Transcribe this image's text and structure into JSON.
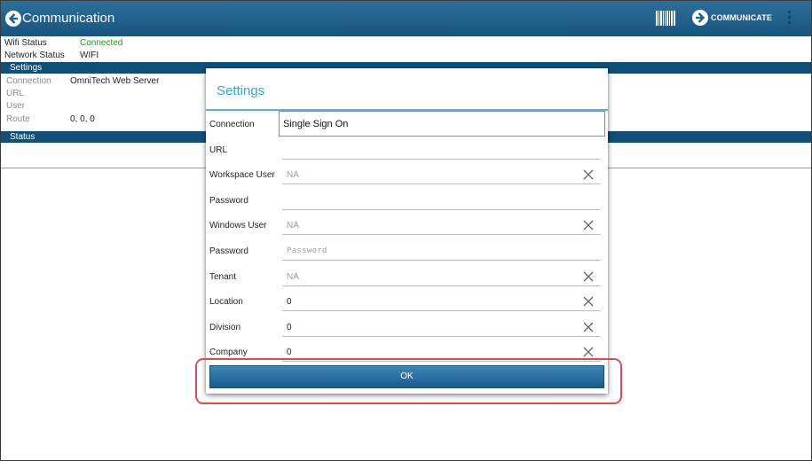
{
  "appbar": {
    "title": "Communication",
    "communicate_label": "COMMUNICATE"
  },
  "status_info": {
    "wifi_label": "Wifi Status",
    "wifi_value": "Connected",
    "wifi_color": "#1a9a1a",
    "network_label": "Network Status",
    "network_value": "WIFI"
  },
  "settings_section": {
    "header": "Settings",
    "connection_label": "Connection",
    "connection_value": "OmniTech Web Server",
    "url_label": "URL",
    "user_label": "User",
    "route_label": "Route",
    "route_value": "0, 0, 0"
  },
  "status_section": {
    "header": "Status"
  },
  "dialog": {
    "title": "Settings",
    "connection": {
      "label": "Connection",
      "value": "Single Sign On"
    },
    "fields": [
      {
        "label": "URL",
        "value": "",
        "placeholder": ""
      },
      {
        "label": "Workspace User",
        "value": "",
        "placeholder": "NA"
      },
      {
        "label": "Password",
        "value": "",
        "placeholder": ""
      },
      {
        "label": "Windows User",
        "value": "",
        "placeholder": "NA"
      },
      {
        "label": "Password",
        "value": "",
        "placeholder": "Password"
      },
      {
        "label": "Tenant",
        "value": "",
        "placeholder": "NA"
      },
      {
        "label": "Location",
        "value": "0",
        "placeholder": ""
      },
      {
        "label": "Division",
        "value": "0",
        "placeholder": ""
      },
      {
        "label": "Company",
        "value": "0",
        "placeholder": ""
      }
    ],
    "ok_label": "OK"
  },
  "icons": {
    "back": "back-arrow-icon",
    "barcode": "barcode-icon",
    "communicate": "arrow-right-circle-icon",
    "overflow": "overflow-menu-icon",
    "clear": "close-icon"
  },
  "colors": {
    "appbar": "#1f6190",
    "section_bar": "#0f4f7a",
    "dialog_title": "#33a9d8",
    "highlight": "#e24a4f"
  }
}
